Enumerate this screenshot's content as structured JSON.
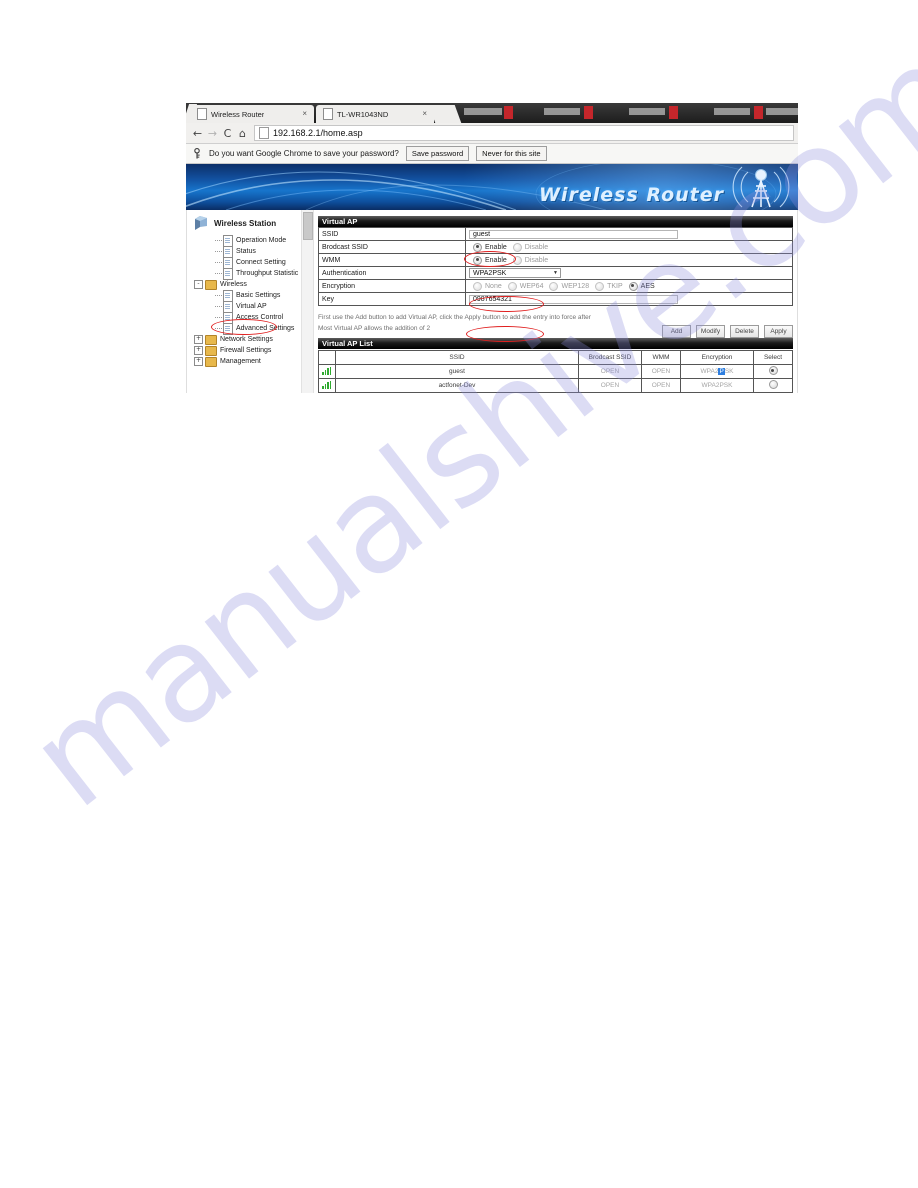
{
  "browser": {
    "tabs": [
      {
        "title": "Wireless Router",
        "close": "×"
      },
      {
        "title": "TL-WR1043ND",
        "close": "×"
      }
    ],
    "nav": {
      "back": "←",
      "forward": "→",
      "reload": "C",
      "home": "⌂"
    },
    "url": "192.168.2.1/home.asp",
    "infobar": {
      "message": "Do you want Google Chrome to save your password?",
      "save_label": "Save password",
      "never_label": "Never for this site"
    }
  },
  "banner": {
    "title": "Wireless Router"
  },
  "sidebar": {
    "station_title": "Wireless Station",
    "items": [
      {
        "label": "Operation Mode",
        "level": 2,
        "icon": "document-icon",
        "twisty": ""
      },
      {
        "label": "Status",
        "level": 2,
        "icon": "document-icon",
        "twisty": ""
      },
      {
        "label": "Connect Setting",
        "level": 2,
        "icon": "document-icon",
        "twisty": ""
      },
      {
        "label": "Throughput Statistic",
        "level": 2,
        "icon": "document-icon",
        "twisty": ""
      },
      {
        "label": "Wireless",
        "level": 1,
        "icon": "folder-icon",
        "twisty": "-"
      },
      {
        "label": "Basic Settings",
        "level": 3,
        "icon": "document-icon",
        "twisty": ""
      },
      {
        "label": "Virtual AP",
        "level": 3,
        "icon": "document-icon",
        "twisty": "",
        "highlighted": true
      },
      {
        "label": "Access Control",
        "level": 3,
        "icon": "document-icon",
        "twisty": ""
      },
      {
        "label": "Advanced Settings",
        "level": 3,
        "icon": "document-icon",
        "twisty": ""
      },
      {
        "label": "Network Settings",
        "level": 1,
        "icon": "folder-icon",
        "twisty": "+"
      },
      {
        "label": "Firewall Settings",
        "level": 1,
        "icon": "folder-icon",
        "twisty": "+"
      },
      {
        "label": "Management",
        "level": 1,
        "icon": "folder-icon",
        "twisty": "+"
      }
    ]
  },
  "form": {
    "panel_title": "Virtual AP",
    "ssid": {
      "label": "SSID",
      "value": "guest"
    },
    "broadcast_ssid": {
      "label": "Brodcast SSID",
      "options": [
        "Enable",
        "Disable"
      ],
      "selected": "Enable"
    },
    "wmm": {
      "label": "WMM",
      "options": [
        "Enable",
        "Disable"
      ],
      "selected": "Enable"
    },
    "authentication": {
      "label": "Authentication",
      "value": "WPA2PSK",
      "caret": "▼"
    },
    "encryption": {
      "label": "Encryption",
      "options": [
        "None",
        "WEP64",
        "WEP128",
        "TKIP",
        "AES"
      ],
      "selected": "AES"
    },
    "key": {
      "label": "Key",
      "value": "0987654321"
    }
  },
  "help": {
    "line1": "First use the Add button to add Virtual AP, click the Apply button to add the entry into force after",
    "line2": "Most Virtual AP allows the addition of 2"
  },
  "buttons": [
    {
      "label": "Add"
    },
    {
      "label": "Modify"
    },
    {
      "label": "Delete"
    },
    {
      "label": "Apply"
    }
  ],
  "list": {
    "panel_title": "Virtual AP List",
    "columns": [
      "",
      "SSID",
      "Brodcast SSID",
      "WMM",
      "Encryption",
      "Select"
    ],
    "rows": [
      {
        "signal": "signal-bars-icon",
        "ssid": "guest",
        "broadcast": "OPEN",
        "wmm": "OPEN",
        "encryption_pre": "WPA2",
        "encryption_sel": "P",
        "encryption_post": "SK",
        "selected": true
      },
      {
        "signal": "signal-bars-icon",
        "ssid": "actfonet-Dev",
        "broadcast": "OPEN",
        "wmm": "OPEN",
        "encryption_pre": "WPA2PSK",
        "encryption_sel": "",
        "encryption_post": "",
        "selected": false
      }
    ]
  },
  "watermark": {
    "text": "manualshive.com"
  },
  "colors": {
    "annotation": "#e02020",
    "banner_blue": "#1775cc",
    "signal_green": "#2faa2f",
    "selection_blue": "#2f7fe0"
  }
}
